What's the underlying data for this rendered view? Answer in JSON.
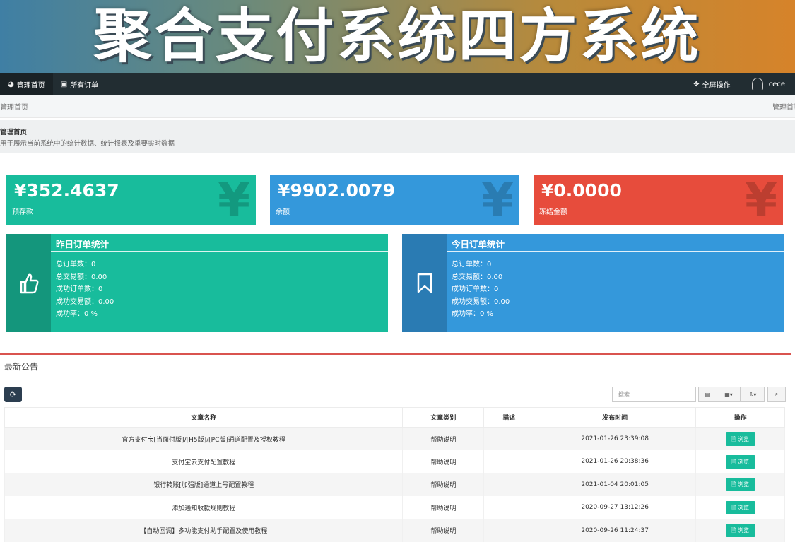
{
  "banner": {
    "title": "聚合支付系统四方系统"
  },
  "nav": {
    "home": "管理首页",
    "orders": "所有订单",
    "fullscreen": "全屏操作",
    "user": "cece"
  },
  "breadcrumb": {
    "left": "管理首页",
    "right": "管理首页"
  },
  "page": {
    "title": "管理首页",
    "desc": "用于展示当前系统中的统计数据、统计报表及重要实时数据"
  },
  "stats": [
    {
      "amount": "¥352.4637",
      "label": "预存款",
      "color": "#18bc9c"
    },
    {
      "amount": "¥9902.0079",
      "label": "余额",
      "color": "#3498db"
    },
    {
      "amount": "¥0.0000",
      "label": "冻结金额",
      "color": "#e74c3c"
    }
  ],
  "yesterday": {
    "title": "昨日订单统计",
    "rows": [
      "总订单数：0",
      "总交易额：0.00",
      "成功订单数：0",
      "成功交易额：0.00",
      "成功率：0 %"
    ]
  },
  "today": {
    "title": "今日订单统计",
    "rows": [
      "总订单数：0",
      "总交易额：0.00",
      "成功订单数：0",
      "成功交易额：0.00",
      "成功率：0 %"
    ]
  },
  "announcements": {
    "title": "最新公告",
    "search_placeholder": "搜索",
    "columns": [
      "文章名称",
      "文章类别",
      "描述",
      "发布时间",
      "操作"
    ],
    "view_label": "浏览",
    "rows": [
      {
        "name": "官方支付宝[当面付版]/[H5版]/[PC版]通道配置及授权教程",
        "cat": "帮助说明",
        "desc": "",
        "time": "2021-01-26 23:39:08"
      },
      {
        "name": "支付宝云支付配置教程",
        "cat": "帮助说明",
        "desc": "",
        "time": "2021-01-26 20:38:36"
      },
      {
        "name": "银行转账[加强版]通道上号配置教程",
        "cat": "帮助说明",
        "desc": "",
        "time": "2021-01-04 20:01:05"
      },
      {
        "name": "添加通知收款规则教程",
        "cat": "帮助说明",
        "desc": "",
        "time": "2020-09-27 13:12:26"
      },
      {
        "name": "【自动回调】多功能支付助手配置及使用教程",
        "cat": "帮助说明",
        "desc": "",
        "time": "2020-09-26 11:24:37"
      }
    ]
  }
}
